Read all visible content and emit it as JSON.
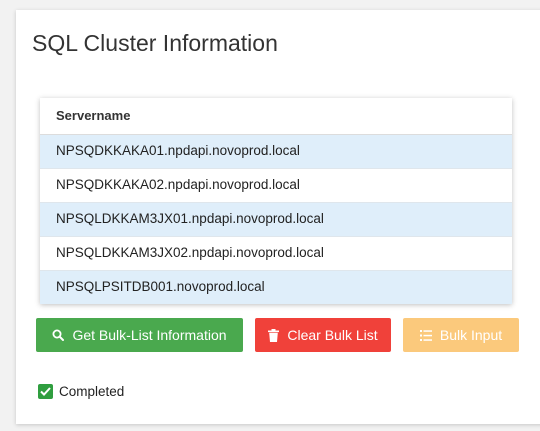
{
  "page": {
    "title": "SQL Cluster Information"
  },
  "table": {
    "header": "Servername",
    "rows": [
      "NPSQDKKAKA01.npdapi.novoprod.local",
      "NPSQDKKAKA02.npdapi.novoprod.local",
      "NPSQLDKKAM3JX01.npdapi.novoprod.local",
      "NPSQLDKKAM3JX02.npdapi.novoprod.local",
      "NPSQLPSITDB001.novoprod.local"
    ]
  },
  "buttons": {
    "get_bulk": {
      "label": "Get Bulk-List Information",
      "icon": "search-icon",
      "color": "#4aa94e"
    },
    "clear_bulk": {
      "label": "Clear Bulk List",
      "icon": "trash-icon",
      "color": "#f0413a"
    },
    "bulk_input": {
      "label": "Bulk Input",
      "icon": "list-icon",
      "color": "#fbc97c"
    }
  },
  "status": {
    "completed_label": "Completed",
    "completed_checked": true,
    "check_color": "#2f9e3f"
  },
  "colors": {
    "row_highlight": "#dfeefa"
  }
}
